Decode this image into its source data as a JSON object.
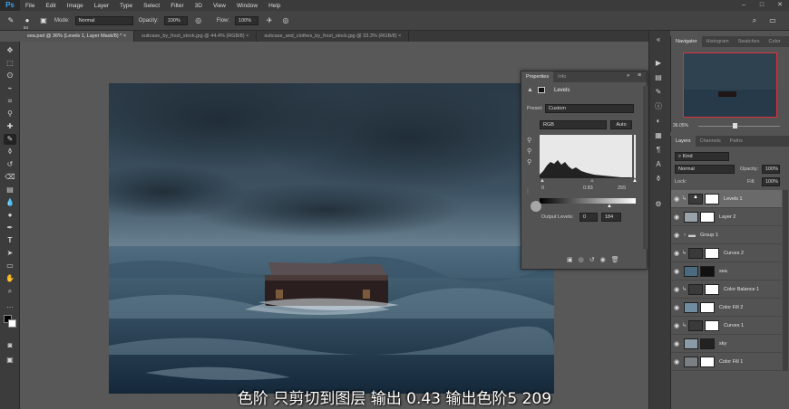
{
  "app": {
    "logo": "Ps",
    "menu": [
      "File",
      "Edit",
      "Image",
      "Layer",
      "Type",
      "Select",
      "Filter",
      "3D",
      "View",
      "Window",
      "Help"
    ]
  },
  "options_bar": {
    "brush_size": "84",
    "mode_label": "Mode:",
    "mode_value": "Normal",
    "opacity_label": "Opacity:",
    "opacity_value": "100%",
    "flow_label": "Flow:",
    "flow_value": "100%"
  },
  "tabs": [
    "sea.psd @ 36% (Levels 1, Layer Mask/8) *",
    "suitcase_by_frozt_stock.jpg @ 44.4% (RGB/8)",
    "suitcase_and_clothes_by_frozt_stock.jpg @ 33.3% (RGB/8)"
  ],
  "navigator": {
    "tabs": [
      "Navigator",
      "Histogram",
      "Swatches",
      "Color"
    ],
    "zoom": "36.05%"
  },
  "properties": {
    "tabs": [
      "Properties",
      "Info"
    ],
    "title": "Levels",
    "preset_label": "Preset:",
    "preset_value": "Custom",
    "channel": "RGB",
    "auto_label": "Auto",
    "input_min": "0",
    "input_mid": "0.83",
    "input_max": "255",
    "output_label": "Output Levels:",
    "output_min": "0",
    "output_max": "184"
  },
  "layers_panel": {
    "tabs": [
      "Layers",
      "Channels",
      "Paths"
    ],
    "kind_label": "Kind",
    "blend_mode": "Normal",
    "opacity_label": "Opacity:",
    "opacity_value": "100%",
    "lock_label": "Lock:",
    "fill_label": "Fill:",
    "fill_value": "100%",
    "layers": [
      {
        "name": "Levels 1",
        "selected": true
      },
      {
        "name": "Layer 2",
        "selected": false
      },
      {
        "name": "Group 1",
        "selected": false
      },
      {
        "name": "Curves 2",
        "selected": false
      },
      {
        "name": "sea",
        "selected": false
      },
      {
        "name": "Color Balance 1",
        "selected": false
      },
      {
        "name": "Color Fill 2",
        "selected": false
      },
      {
        "name": "Curves 1",
        "selected": false
      },
      {
        "name": "sky",
        "selected": false
      },
      {
        "name": "Color Fill 1",
        "selected": false
      }
    ]
  },
  "subtitle": "色阶  只剪切到图层   输出 0.43  输出色阶5  209"
}
